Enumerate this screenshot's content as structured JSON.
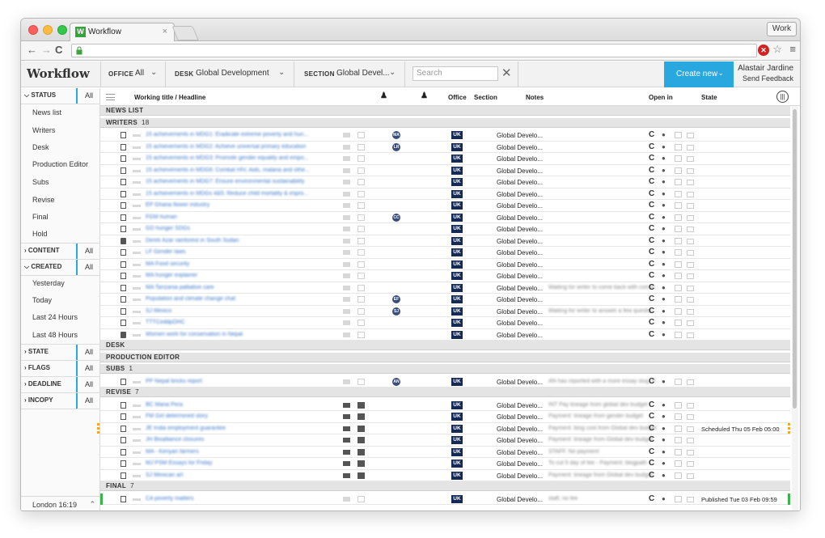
{
  "browser": {
    "tab_title": "Workflow",
    "tab_close": "×",
    "profile": "Work",
    "back": "←",
    "forward": "→",
    "reload": "C",
    "favicon_letter": "W"
  },
  "app": {
    "title": "Workflow",
    "filters": {
      "office_label": "OFFICE",
      "office_value": "All",
      "desk_label": "DESK",
      "desk_value": "Global Development",
      "section_label": "SECTION",
      "section_value": "Global Devel..."
    },
    "search_placeholder": "Search",
    "create_new": "Create new",
    "user_name": "Alastair Jardine",
    "send_feedback": "Send Feedback",
    "accent_color": "#29a7df"
  },
  "sidebar": {
    "status_label": "STATUS",
    "status_all": "All",
    "status_items": [
      "News list",
      "Writers",
      "Desk",
      "Production Editor",
      "Subs",
      "Revise",
      "Final",
      "Hold"
    ],
    "content_label": "CONTENT",
    "content_all": "All",
    "created_label": "CREATED",
    "created_all": "All",
    "created_items": [
      "Yesterday",
      "Today",
      "Last 24 Hours",
      "Last 48 Hours"
    ],
    "state_label": "STATE",
    "state_all": "All",
    "flags_label": "FLAGS",
    "flags_all": "All",
    "deadline_label": "DEADLINE",
    "deadline_all": "All",
    "incopy_label": "INCOPY",
    "incopy_all": "All",
    "footer": "London 16:19"
  },
  "columns": {
    "title": "Working title / Headline",
    "office": "Office",
    "section": "Section",
    "notes": "Notes",
    "open_in": "Open in",
    "state": "State"
  },
  "sections": {
    "news_list": "NEWS LIST",
    "writers": "WRITERS",
    "writers_count": "18",
    "desk": "DESK",
    "production_editor": "PRODUCTION EDITOR",
    "subs": "SUBS",
    "subs_count": "1",
    "revise": "REVISE",
    "revise_count": "7",
    "final": "FINAL",
    "final_count": "7"
  },
  "rows": {
    "writers": [
      {
        "title": "15 achievements in MDG1: Eradicate extreme poverty and hun...",
        "avatar": "MA",
        "office": "UK",
        "section": "Global Develo...",
        "note": ""
      },
      {
        "title": "15 achievements in MDG2: Achieve universal primary education",
        "avatar": "LR",
        "office": "UK",
        "section": "Global Develo...",
        "note": ""
      },
      {
        "title": "15 achievements in MDG3: Promote gender equality and empo...",
        "avatar": "",
        "office": "UK",
        "section": "Global Develo...",
        "note": ""
      },
      {
        "title": "15 achievements in MDG6: Combat HIV, Aids, malaria and othe...",
        "avatar": "",
        "office": "UK",
        "section": "Global Develo...",
        "note": ""
      },
      {
        "title": "15 achievements in MDG7: Ensure environmental sustainability",
        "avatar": "",
        "office": "UK",
        "section": "Global Develo...",
        "note": ""
      },
      {
        "title": "15 achievements in MDGs 4&5: Reduce child mortality & impro...",
        "avatar": "",
        "office": "UK",
        "section": "Global Develo...",
        "note": ""
      },
      {
        "title": "EP Ghana flower industry",
        "avatar": "",
        "office": "UK",
        "section": "Global Develo...",
        "note": ""
      },
      {
        "title": "FGM human",
        "avatar": "CC",
        "office": "UK",
        "section": "Global Develo...",
        "note": ""
      },
      {
        "title": "GD hunger SDGs",
        "avatar": "",
        "office": "UK",
        "section": "Global Develo...",
        "note": ""
      },
      {
        "title": "Derek Azar rainforest in South Sudan",
        "avatar": "",
        "office": "UK",
        "section": "Global Develo...",
        "note": "",
        "camera": true
      },
      {
        "title": "LF Gender laws",
        "avatar": "",
        "office": "UK",
        "section": "Global Develo...",
        "note": ""
      },
      {
        "title": "MA Food security",
        "avatar": "",
        "office": "UK",
        "section": "Global Develo...",
        "note": ""
      },
      {
        "title": "MA hunger explainer",
        "avatar": "",
        "office": "UK",
        "section": "Global Develo...",
        "note": ""
      },
      {
        "title": "MA Tanzania palliative care",
        "avatar": "",
        "office": "UK",
        "section": "Global Develo...",
        "note": "Waiting for writer to come back with comm..."
      },
      {
        "title": "Population and climate change chat",
        "avatar": "EF",
        "office": "UK",
        "section": "Global Develo...",
        "note": ""
      },
      {
        "title": "SJ Mexico",
        "avatar": "SJ",
        "office": "UK",
        "section": "Global Develo...",
        "note": "Waiting for writer to answer a few questio..."
      },
      {
        "title": "TTTCeddpDHC",
        "avatar": "",
        "office": "UK",
        "section": "Global Develo...",
        "note": ""
      },
      {
        "title": "Women work for conservation in Nepal",
        "avatar": "",
        "office": "UK",
        "section": "Global Develo...",
        "note": "",
        "camera": true
      }
    ],
    "subs": [
      {
        "title": "PP Nepal bricks report",
        "avatar": "AN",
        "office": "UK",
        "section": "Global Develo...",
        "note": "AN has reported with a more essay slug, P..."
      }
    ],
    "revise": [
      {
        "title": "BC Maria Pera",
        "office": "UK",
        "section": "Global Develo...",
        "note": "INT Pay lineage from global dev budget",
        "state": ""
      },
      {
        "title": "FM Girl determined story",
        "office": "UK",
        "section": "Global Develo...",
        "note": "Payment: lineage from gender budget",
        "state": ""
      },
      {
        "title": "JE India employment guarantee",
        "office": "UK",
        "section": "Global Develo...",
        "note": "Payment: blog cost from Global dev budget",
        "state": "Scheduled Thu 05 Feb 05:00",
        "mark": true
      },
      {
        "title": "JH Bioalliance closures",
        "office": "UK",
        "section": "Global Develo...",
        "note": "Payment: lineage from Global dev budget",
        "state": ""
      },
      {
        "title": "MA - Kenyan farmers",
        "office": "UK",
        "section": "Global Develo...",
        "note": "STAFF. No payment",
        "state": ""
      },
      {
        "title": "MJ PSM Essays for Friday",
        "office": "UK",
        "section": "Global Develo...",
        "note": "To cut 5 day of fee - Payment: blogpath -...",
        "state": ""
      },
      {
        "title": "SJ Mexican art",
        "office": "UK",
        "section": "Global Develo...",
        "note": "Payment: lineage from Global dev budget",
        "state": ""
      }
    ],
    "final": [
      {
        "title": "CA poverty matters",
        "office": "UK",
        "section": "Global Develo...",
        "note": "staff, no fee",
        "state": "Published Tue 03 Feb 09:59"
      }
    ]
  }
}
